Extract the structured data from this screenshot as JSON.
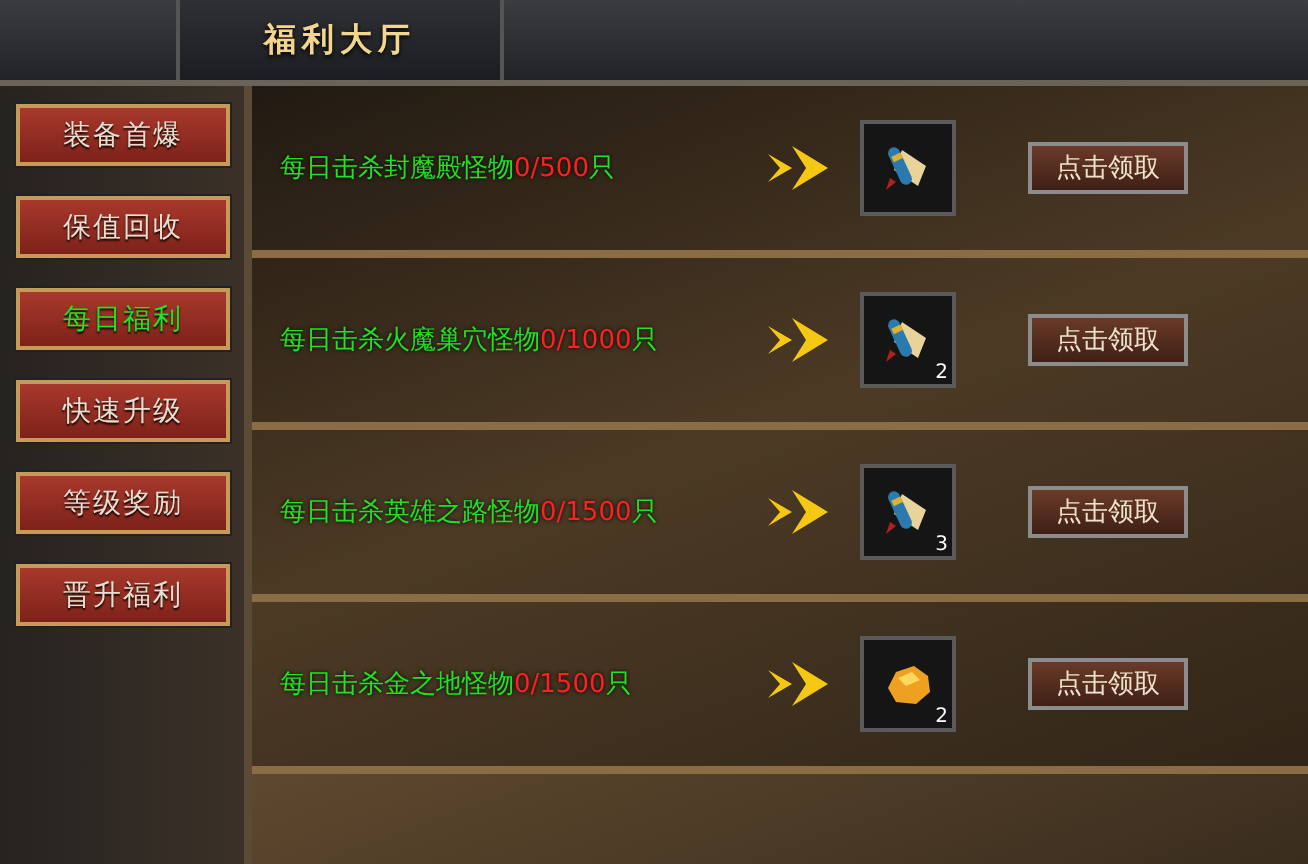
{
  "window": {
    "title": "福利大厅"
  },
  "sidebar": {
    "items": [
      {
        "label": "装备首爆",
        "selected": false
      },
      {
        "label": "保值回收",
        "selected": false
      },
      {
        "label": "每日福利",
        "selected": true
      },
      {
        "label": "快速升级",
        "selected": false
      },
      {
        "label": "等级奖励",
        "selected": false
      },
      {
        "label": "晋升福利",
        "selected": false
      }
    ]
  },
  "tasks": [
    {
      "task": "每日击杀封魔殿怪物",
      "progress": "0/500",
      "unit": "只",
      "item": {
        "kind": "scroll"
      },
      "button": "点击领取"
    },
    {
      "task": "每日击杀火魔巢穴怪物",
      "progress": "0/1000",
      "unit": "只",
      "item": {
        "kind": "scroll",
        "count": "2"
      },
      "button": "点击领取"
    },
    {
      "task": "每日击杀英雄之路怪物",
      "progress": "0/1500",
      "unit": "只",
      "item": {
        "kind": "scroll",
        "count": "3"
      },
      "button": "点击领取"
    },
    {
      "task": "每日击杀金之地怪物",
      "progress": "0/1500",
      "unit": "只",
      "item": {
        "kind": "gold",
        "count": "2"
      },
      "button": "点击领取"
    }
  ]
}
